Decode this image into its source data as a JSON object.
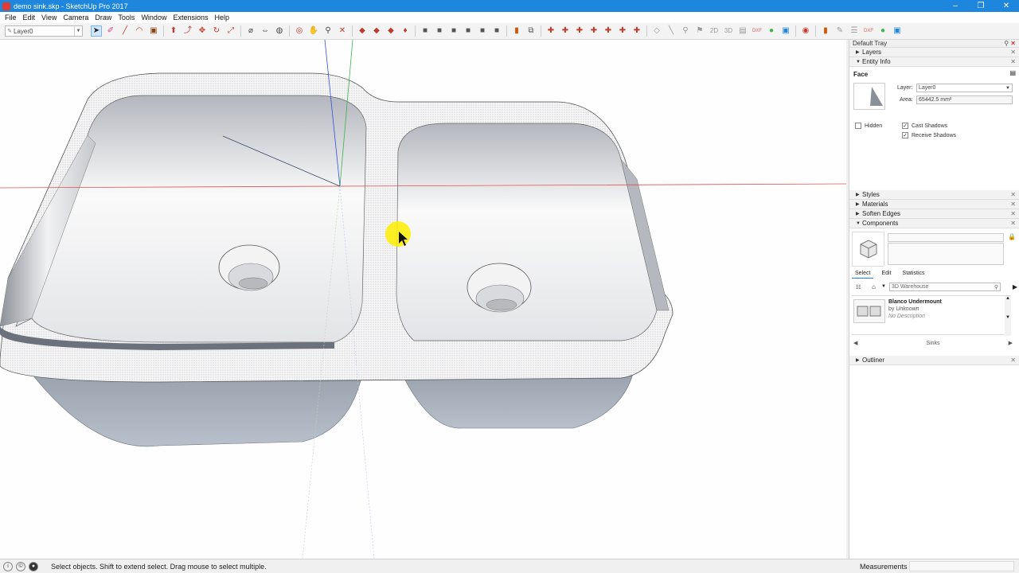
{
  "window": {
    "title": "demo sink.skp - SketchUp Pro 2017",
    "controls": [
      "–",
      "❐",
      "✕"
    ]
  },
  "menu": [
    "File",
    "Edit",
    "View",
    "Camera",
    "Draw",
    "Tools",
    "Window",
    "Extensions",
    "Help"
  ],
  "toolbar": {
    "layer_value": "Layer0"
  },
  "tray": {
    "title": "Default Tray",
    "panels": {
      "layers": "Layers",
      "entity_info": "Entity Info",
      "styles": "Styles",
      "materials": "Materials",
      "soften_edges": "Soften Edges",
      "components": "Components",
      "outliner": "Outliner"
    },
    "entity": {
      "type": "Face",
      "layer_label": "Layer:",
      "layer_value": "Layer0",
      "area_label": "Area:",
      "area_value": "65442.5 mm²",
      "hidden_label": "Hidden",
      "cast_label": "Cast Shadows",
      "receive_label": "Receive Shadows"
    },
    "components": {
      "tabs": [
        "Select",
        "Edit",
        "Statistics"
      ],
      "search_value": "3D Warehouse",
      "item_name": "Blanco Undermount",
      "item_by_prefix": "by",
      "item_by": "Unknown",
      "item_desc": "No Description",
      "footer": "Sinks"
    }
  },
  "status": {
    "message": "Select objects. Shift to extend select. Drag mouse to select multiple.",
    "measurements_label": "Measurements"
  },
  "colors": {
    "titlebar": "#1e86dc",
    "axis_red": "#e05050",
    "axis_green": "#3bb54a",
    "axis_blue": "#3050e0"
  }
}
